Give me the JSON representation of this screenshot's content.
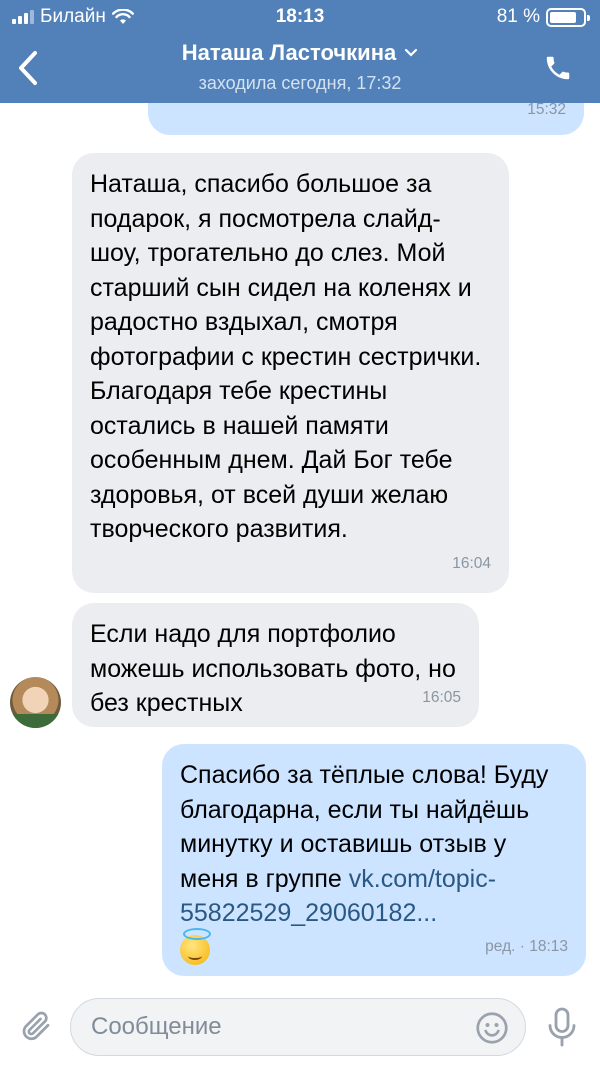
{
  "status_bar": {
    "carrier": "Билайн",
    "time": "18:13",
    "battery": "81 %",
    "battery_level": 0.81
  },
  "header": {
    "contact_name": "Наташа Ласточкина",
    "last_seen": "заходила сегодня, 17:32",
    "icons": [
      "back-icon",
      "chevron-down-icon",
      "phone-icon"
    ],
    "accent_color": "#5181b8"
  },
  "messages": [
    {
      "direction": "out",
      "text": "",
      "time": "15:32"
    },
    {
      "direction": "in",
      "text": "Наташа, спасибо большое за подарок, я посмотрела слайд-шоу, трогательно до слез. Мой старший сын сидел на коленях и радостно вздыхал, смотря фотографии с крестин сестрички. Благодаря тебе крестины остались в нашей памяти особенным днем. Дай Бог тебе здоровья, от всей души желаю творческого развития.",
      "time": "16:04"
    },
    {
      "direction": "in",
      "text": "Если надо для портфолио можешь использовать фото, но без крестных",
      "time": "16:05",
      "avatar": true
    },
    {
      "direction": "out",
      "text": "Спасибо за тёплые слова! Буду благодарна, если ты найдёшь минутку и оставишь отзыв у меня в группе",
      "link": "vk.com/topic-55822529_29060182...",
      "emoji": "smiling-face-with-halo",
      "time": "ред. · 18:13"
    }
  ],
  "composer": {
    "placeholder": "Сообщение",
    "icons": [
      "paperclip-icon",
      "smile-icon",
      "microphone-icon"
    ]
  },
  "colors": {
    "incoming_bubble": "#ebedf0",
    "outgoing_bubble": "#cce4ff",
    "link": "#2a5885",
    "time": "#8a96a3"
  }
}
